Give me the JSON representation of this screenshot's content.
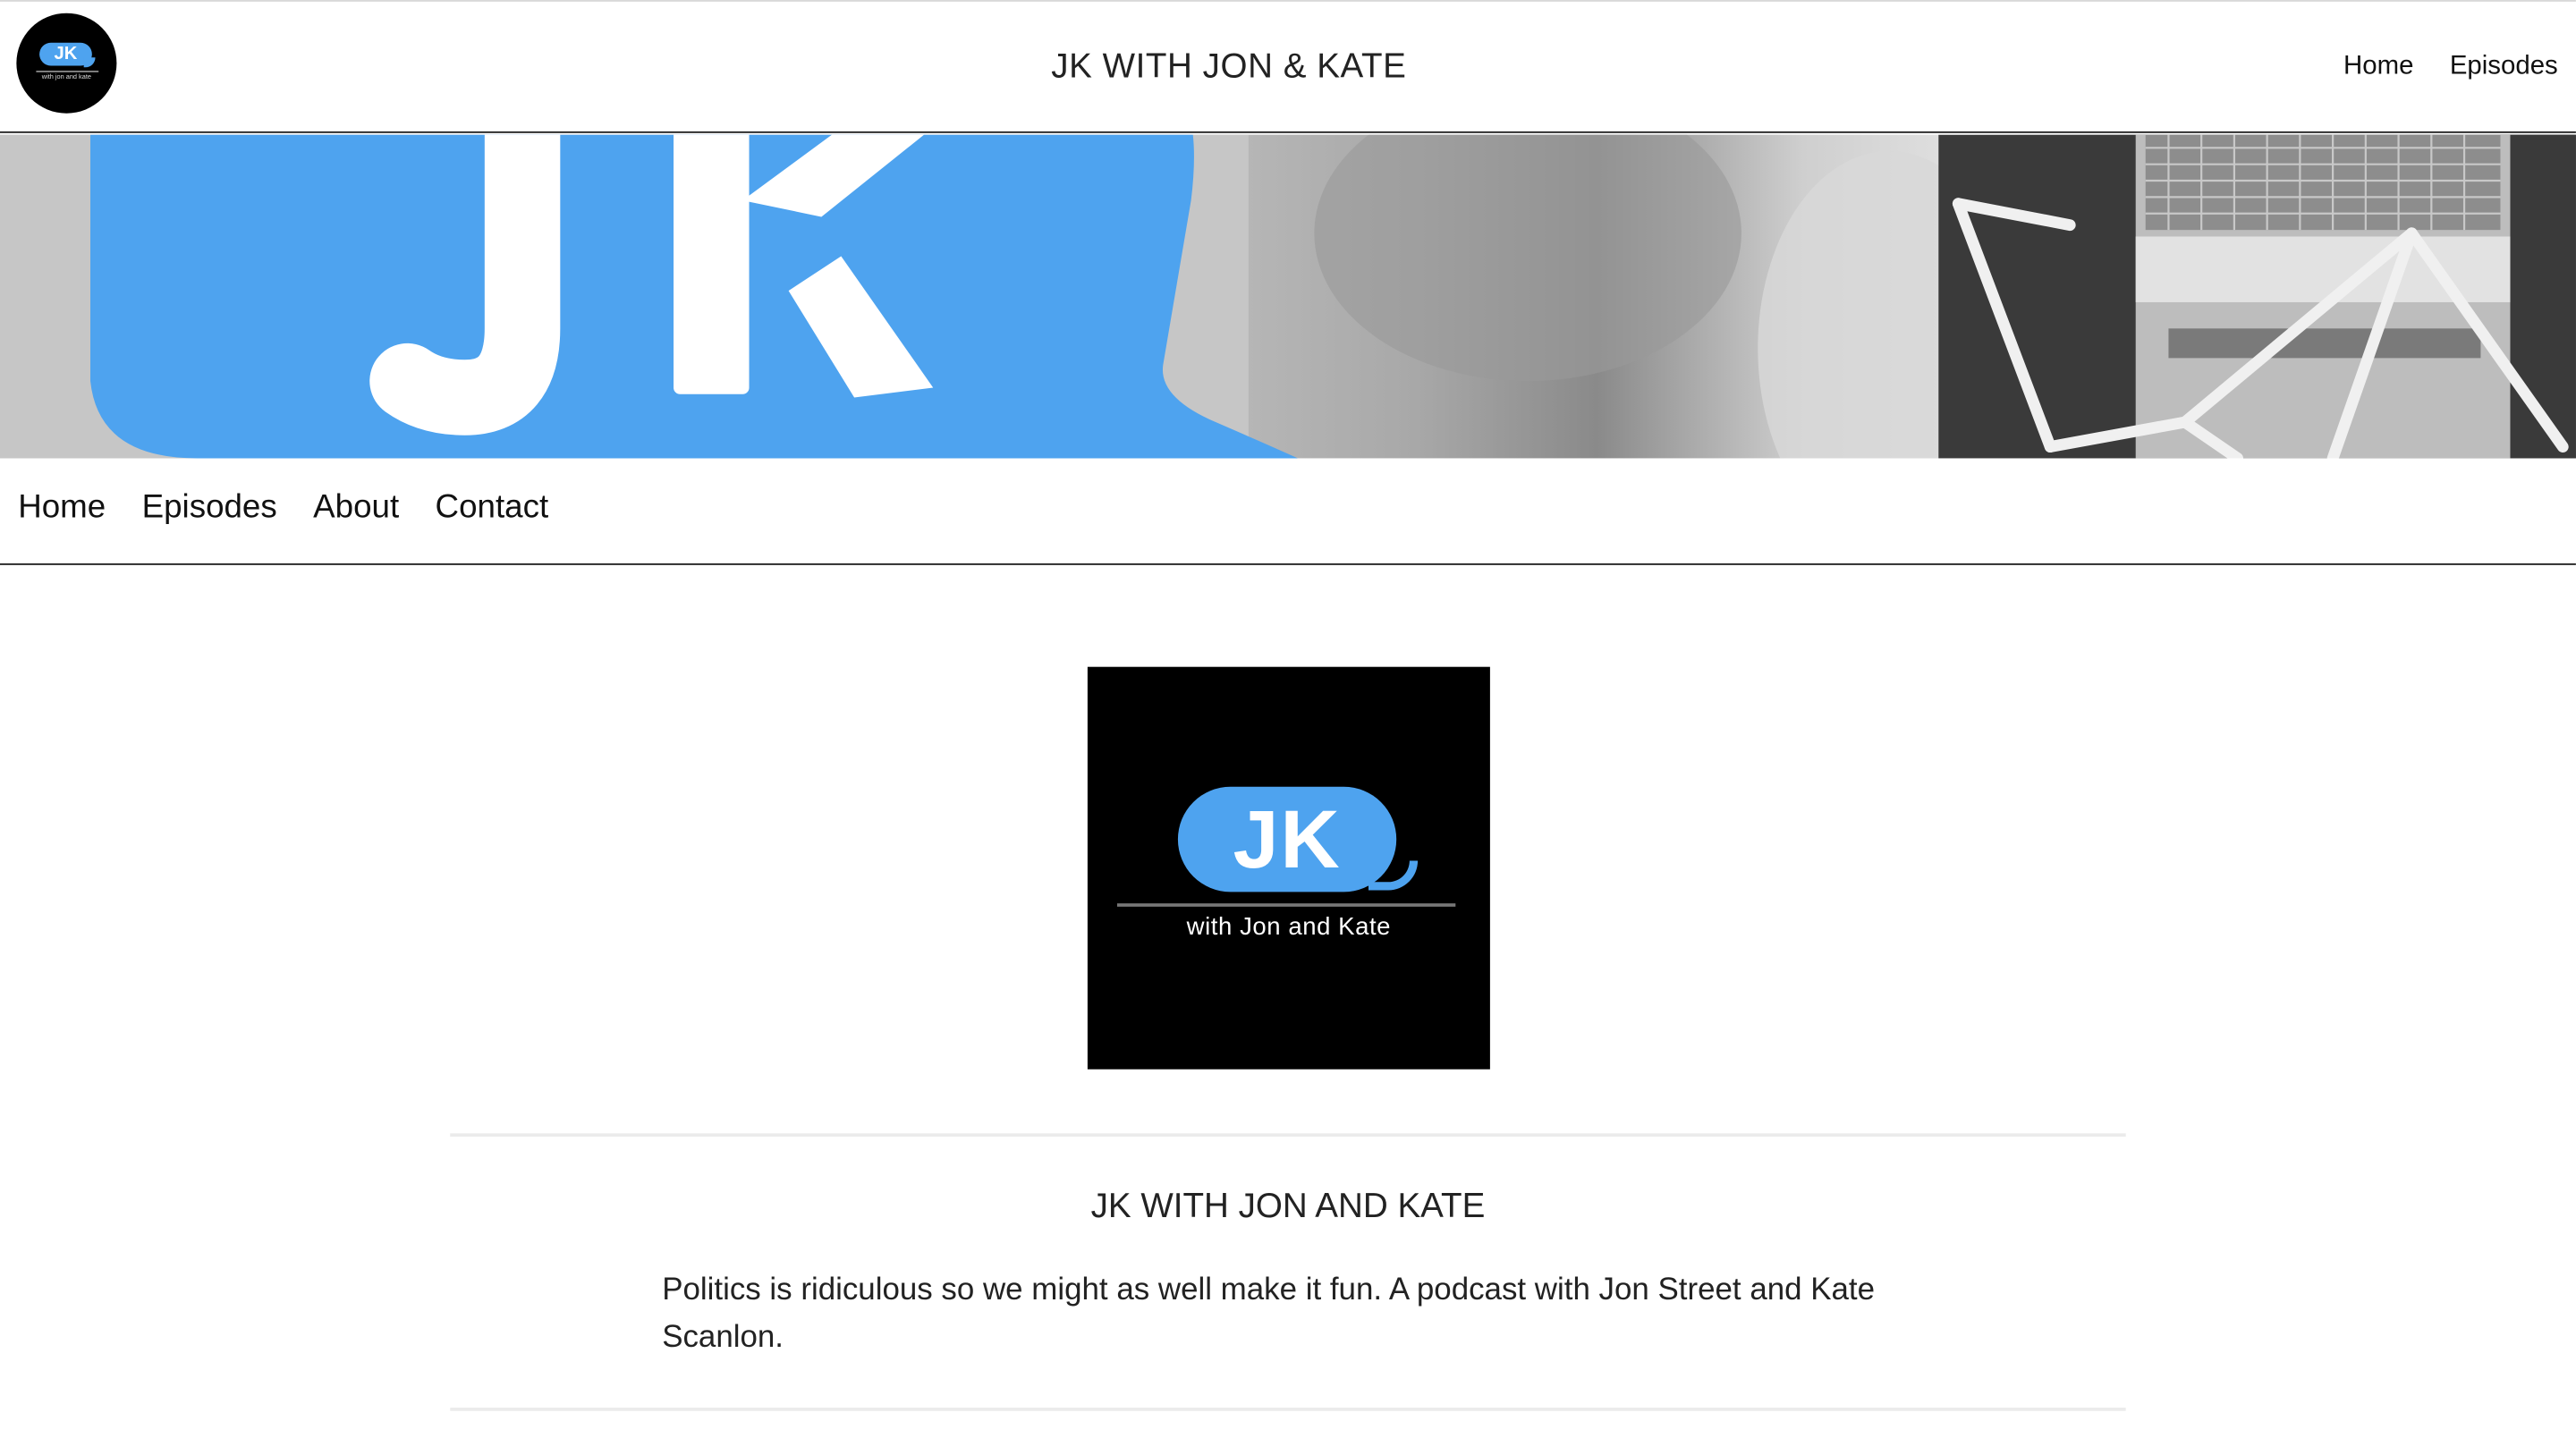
{
  "header": {
    "logo": {
      "text": "JK",
      "subtext": "with jon and kate"
    },
    "site_title": "JK WITH JON & KATE",
    "nav": [
      {
        "label": "Home"
      },
      {
        "label": "Episodes"
      }
    ]
  },
  "banner": {
    "text": "JK",
    "bubble_color": "#4ea3ef"
  },
  "main_nav": [
    {
      "label": "Home"
    },
    {
      "label": "Episodes"
    },
    {
      "label": "About"
    },
    {
      "label": "Contact"
    }
  ],
  "cover_art": {
    "text": "JK",
    "subtext": "with Jon and Kate",
    "background": "#000000",
    "bubble_color": "#4ea3ef"
  },
  "podcast": {
    "title": "JK WITH JON AND KATE",
    "description": "Politics is ridiculous so we might as well make it fun. A podcast with Jon Street and Kate Scanlon."
  }
}
